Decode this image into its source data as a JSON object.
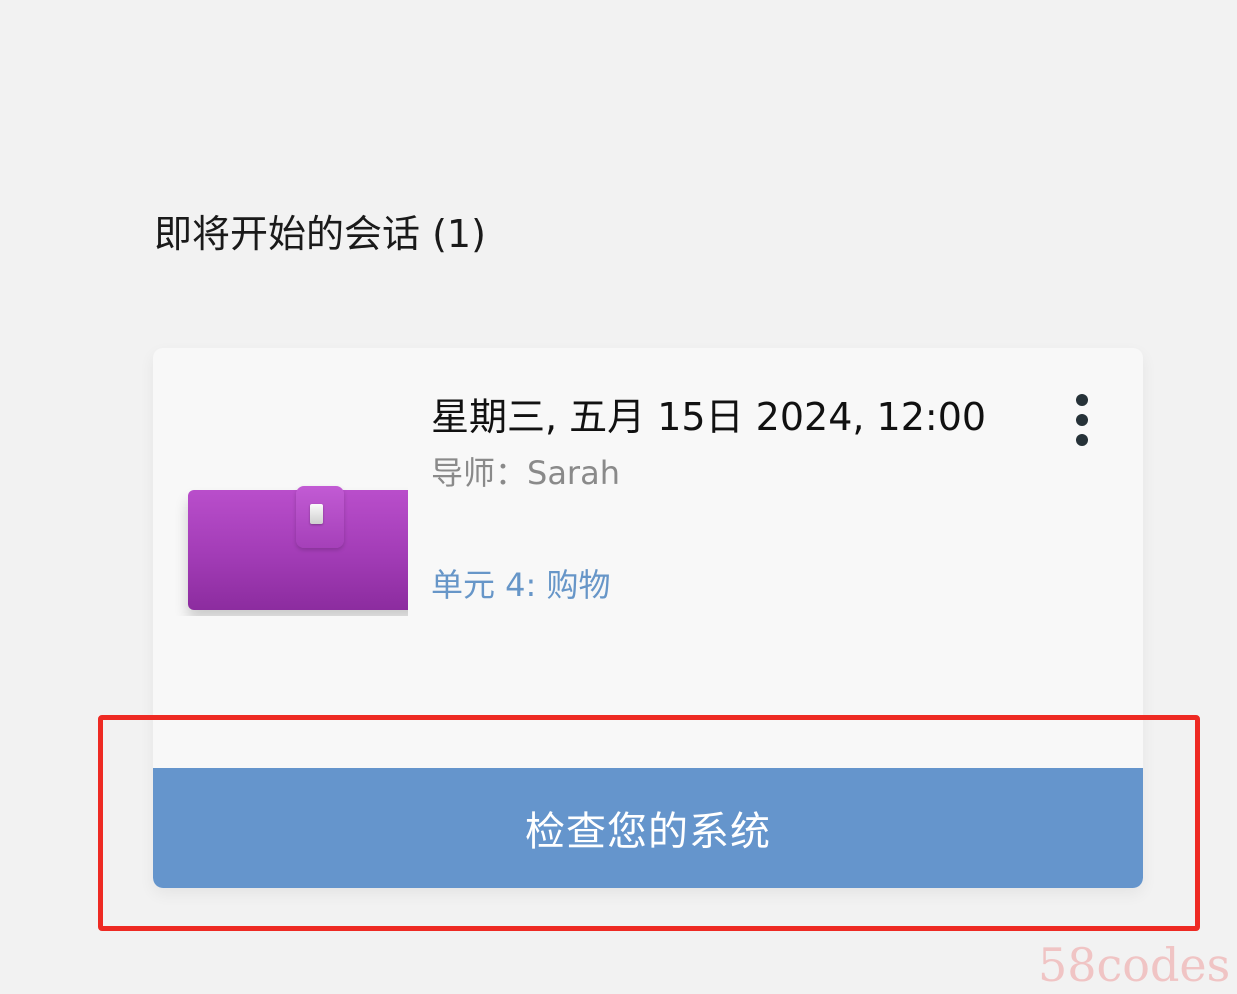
{
  "upcoming": {
    "title": "即将开始的会话 (1)"
  },
  "session": {
    "datetime": "星期三, 五月 15日 2024, 12:00",
    "tutor": "导师：Sarah",
    "unit": "单元 4: 购物",
    "thumbnail_icon": "purple-wallet-image",
    "menu_icon": "more-vertical-icon"
  },
  "actions": {
    "check_system": "检查您的系统"
  },
  "overlay": {
    "highlight_color": "#ee2a23"
  },
  "watermark": {
    "text": "58codes"
  },
  "colors": {
    "button": "#6595cc",
    "unit_text": "#6796c8",
    "background": "#f2f2f2",
    "card": "#f8f8f8"
  }
}
